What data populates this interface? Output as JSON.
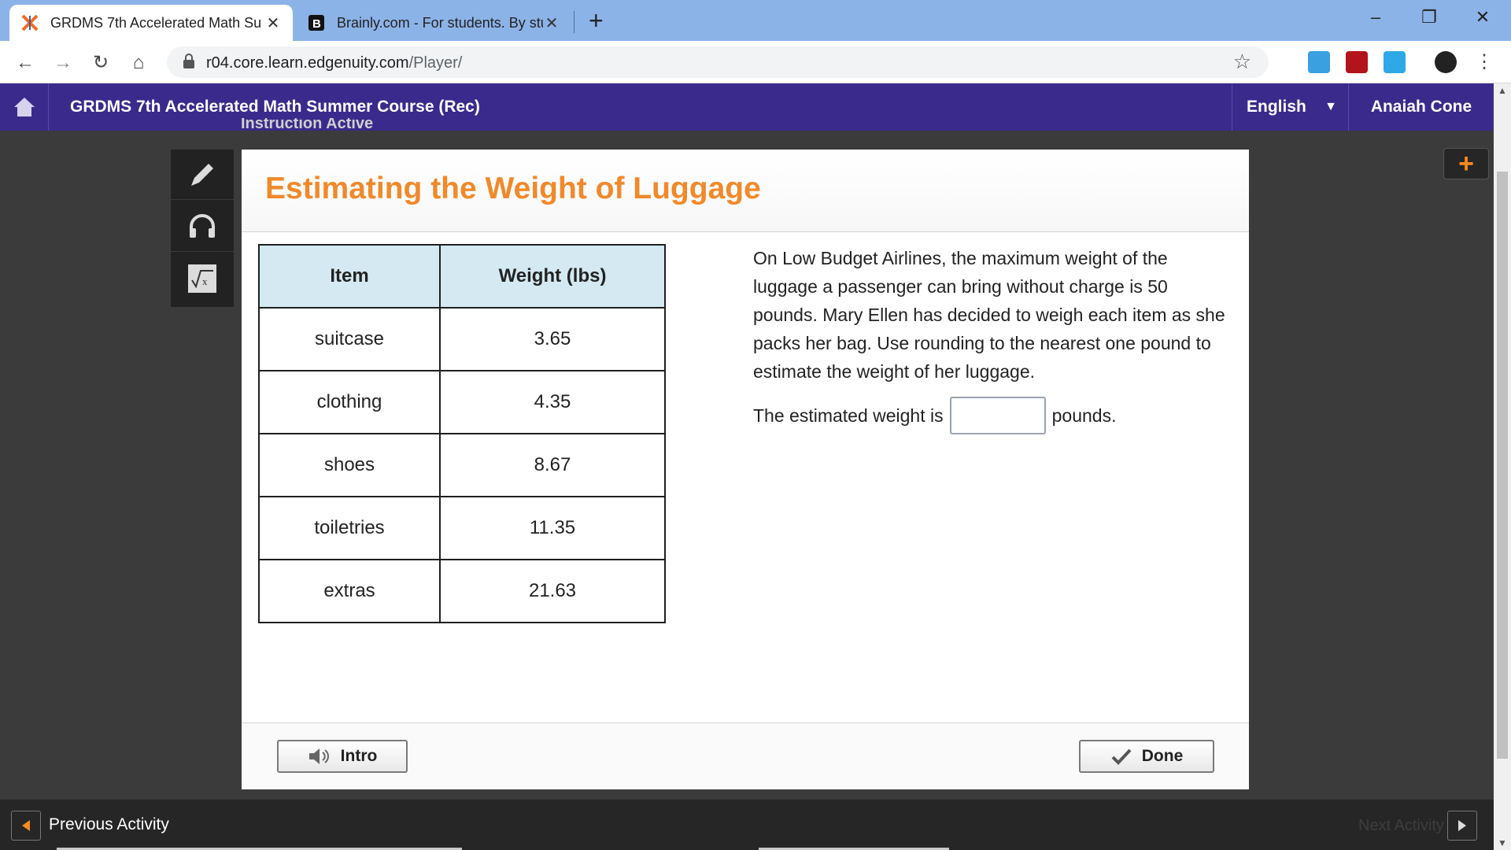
{
  "browser": {
    "tabs": [
      {
        "title": "GRDMS 7th Accelerated Math Su",
        "favicon": "edgenuity-x-icon",
        "active": true
      },
      {
        "title": "Brainly.com - For students. By stu",
        "favicon": "brainly-b-icon",
        "active": false
      }
    ],
    "address": {
      "host": "r04.core.learn.edgenuity.com",
      "path": "/Player/"
    }
  },
  "header": {
    "course_title": "GRDMS 7th Accelerated Math Summer Course (Rec)",
    "language": "English",
    "user_name": "Anaiah Cone",
    "behind_text": "Instruction     Active"
  },
  "activity": {
    "title": "Estimating the Weight of Luggage",
    "table": {
      "headers": [
        "Item",
        "Weight (lbs)"
      ],
      "rows": [
        {
          "item": "suitcase",
          "weight": "3.65"
        },
        {
          "item": "clothing",
          "weight": "4.35"
        },
        {
          "item": "shoes",
          "weight": "8.67"
        },
        {
          "item": "toiletries",
          "weight": "11.35"
        },
        {
          "item": "extras",
          "weight": "21.63"
        }
      ]
    },
    "question": "On Low Budget Airlines, the maximum weight of the luggage a passenger can bring without charge is 50 pounds. Mary Ellen has decided to weigh each item as she packs her bag. Use rounding to the nearest one pound to estimate the weight of her luggage.",
    "answer_prefix": "The estimated weight is",
    "answer_value": "",
    "answer_suffix": "pounds.",
    "intro_label": "Intro",
    "done_label": "Done"
  },
  "footer": {
    "previous_label": "Previous Activity",
    "next_label": "Next Activity"
  },
  "colors": {
    "course_bar": "#3a2a8c",
    "title_orange": "#f0892a",
    "table_header": "#d4e9f2",
    "tabstrip": "#8cb3e8"
  }
}
